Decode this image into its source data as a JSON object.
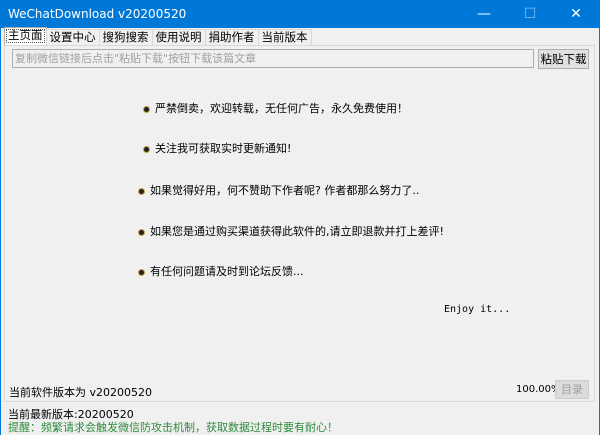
{
  "window": {
    "title": "WeChatDownload v20200520"
  },
  "tabs": [
    "主页面",
    "设置中心",
    "搜狗搜索",
    "使用说明",
    "捐助作者",
    "当前版本"
  ],
  "url_input": {
    "placeholder": "复制微信链接后点击\"粘贴下载\"按钮下载该篇文章",
    "value": ""
  },
  "paste_button": "粘贴下载",
  "notices": [
    "严禁倒卖，欢迎转载，无任何广告，永久免费使用！",
    "关注我可获取实时更新通知!",
    "如果觉得好用，何不赞助下作者呢? 作者都那么努力了..",
    "如果您是通过购买渠道获得此软件的,请立即退款并打上差评!",
    "有任何问题请及时到论坛反馈..."
  ],
  "enjoy": "Enjoy it...",
  "version_label": "当前软件版本为 v20200520",
  "progress": "100.00%",
  "dir_button": "目录",
  "status": {
    "latest": "当前最新版本:20200520",
    "tip": "提醒：频繁请求会触发微信防攻击机制，获取数据过程时要有耐心！"
  }
}
